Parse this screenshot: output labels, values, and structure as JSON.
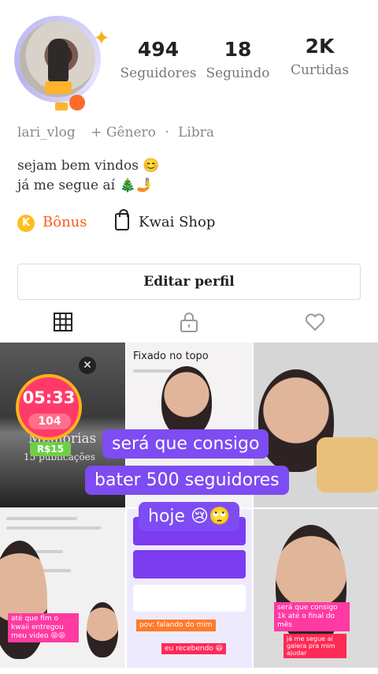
{
  "profile": {
    "username": "lari_vlog",
    "gender": "+ Gênero",
    "separator": "·",
    "zodiac": "Libra",
    "bio_line1": "sejam bem vindos 😊",
    "bio_line2": "já me segue aí 🎄🤳"
  },
  "stats": [
    {
      "value": "494",
      "label": "Seguidores"
    },
    {
      "value": "18",
      "label": "Seguindo"
    },
    {
      "value": "2K",
      "label": "Curtidas"
    }
  ],
  "links": {
    "bonus_icon_text": "K",
    "bonus_label": "Bônus",
    "shop_label": "Kwai Shop"
  },
  "edit_button": "Editar perfil",
  "tabs": [
    {
      "icon": "grid-icon"
    },
    {
      "icon": "lock-icon"
    },
    {
      "icon": "heart-icon"
    }
  ],
  "grid": {
    "c1": {
      "timer": "05:33",
      "coins": "104",
      "title": "Memórias",
      "subtitle": "15 publicações",
      "reward": "R$15",
      "close": "✕"
    },
    "c2": {
      "pinned": "Fixado no topo"
    },
    "c4": {
      "tag": "até que fim o kwaii entregou meu video 😝😝"
    },
    "c5": {
      "tag1": "pov: falando do mim",
      "tag2": "eu recebendo 😃"
    },
    "c6": {
      "tag1": "será que consigo 1k até o final do mês",
      "tag2": "já me segue aí galera pra mim ajudar"
    }
  },
  "caption": {
    "line1": "será que consigo",
    "line2": "bater 500 seguidores",
    "line3": "hoje 😢🙄"
  },
  "colors": {
    "accent_orange": "#ff5a1f",
    "caption_purple": "#7d4cf2",
    "coin_yellow": "#ffbe1f"
  }
}
